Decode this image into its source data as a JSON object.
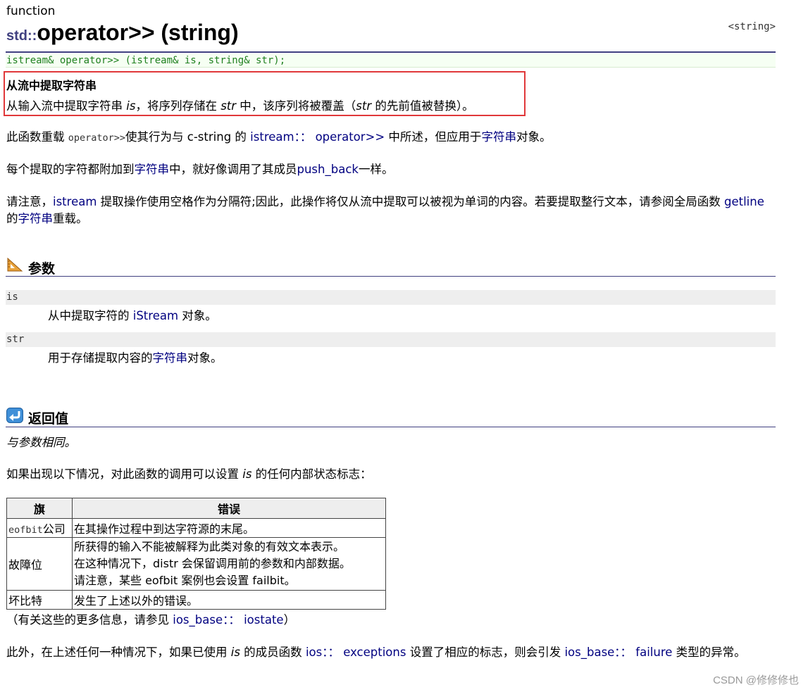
{
  "kind_label": "function",
  "title_ns": "std::",
  "title_main": "operator>> (string)",
  "header_tag": "<string>",
  "prototype": "istream& operator>> (istream& is, string& str);",
  "summary": {
    "short": "从流中提取字符串",
    "desc_a": "从输入流中提取字符串 ",
    "desc_is": "is",
    "desc_b": "，将序列存储在 ",
    "desc_str": "str",
    "desc_c": " 中，该序列将被覆盖（",
    "desc_str2": "str",
    "desc_d": " 的先前值被替换）。"
  },
  "para1": {
    "a": "此函数重载 ",
    "op": "operator>>",
    "b": "使其行为与 c-string 的 ",
    "link": "istream：： operator>>",
    "c": " 中所述，但应用于",
    "link2": "字符串",
    "d": "对象。"
  },
  "para2": {
    "a": "每个提取的字符都附加到",
    "link": "字符串",
    "b": "中，就好像调用了其成员",
    "link2": "push_back",
    "c": "一样。"
  },
  "para3": {
    "a": "请注意，",
    "link": "istream",
    "b": " 提取操作使用空格作为分隔符;因此，此操作将仅从流中提取可以被视为单词的内容。若要提取整行文本，请参阅全局函数 ",
    "link2": "getline",
    "c": " 的",
    "link3": "字符串",
    "d": "重载。"
  },
  "params_section": {
    "title": "参数",
    "items": [
      {
        "name": "is",
        "desc_a": "从中提取字符的 ",
        "link": "iStream",
        "desc_b": " 对象。"
      },
      {
        "name": "str",
        "desc_a": "用于存储提取内容的",
        "link": "字符串",
        "desc_b": "对象。"
      }
    ]
  },
  "return_section": {
    "title": "返回值",
    "text_a": "与参数",
    "text_b": "相同。"
  },
  "para4": {
    "a": "如果出现以下情况，对此函数的调用可以设置 ",
    "is": "is",
    "b": " 的任何内部状态标志："
  },
  "flags_table": {
    "headers": [
      "旗",
      "错误"
    ],
    "rows": [
      {
        "flag_mono": "eofbit",
        "flag_text": "公司",
        "error_lines": [
          "在其操作过程中到达字符源的末尾。"
        ]
      },
      {
        "flag_mono": "",
        "flag_text": "故障位",
        "error_lines": [
          "所获得的输入不能被解释为此类对象的有效文本表示。",
          "在这种情况下，distr 会保留调用前的参数和内部数据。",
          "请注意，某些 eofbit 案例也会设置 failbit。"
        ]
      },
      {
        "flag_mono": "",
        "flag_text": "坏比特",
        "error_lines": [
          "发生了上述以外的错误。"
        ]
      }
    ]
  },
  "more_info": {
    "a": "（有关这些的更多信息，请参见 ",
    "link": "ios_base：： iostate",
    "b": "）"
  },
  "para5": {
    "a": "此外，在上述任何一种情况下，如果已使用 ",
    "is": "is",
    "b": " 的成员函数 ",
    "link": "ios：： exceptions",
    "c": " 设置了相应的标志，则会引发 ",
    "link2": "ios_base：： failure",
    "d": " 类型的异常。"
  },
  "watermark": "CSDN @修修修也",
  "colors": {
    "title_rule": "#404080",
    "link": "#000080",
    "prototype": "#208020",
    "highlight_box": "#e0383a"
  }
}
